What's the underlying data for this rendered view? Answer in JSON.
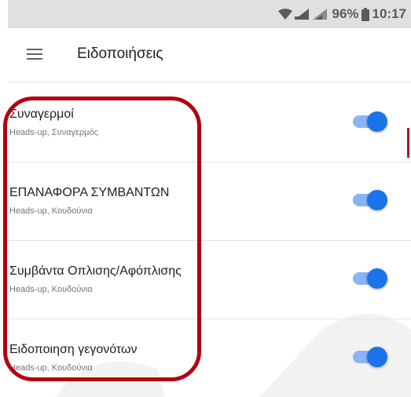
{
  "status_bar": {
    "battery": "96%",
    "time": "10:17",
    "icons": [
      "wifi-icon",
      "signal-icon",
      "signal-icon",
      "battery-icon"
    ]
  },
  "app_bar": {
    "title": "Ειδοποιήσεις",
    "menu_icon": "menu-icon"
  },
  "notifications": [
    {
      "title": "Συναγερμοί",
      "subtitle": "Heads-up, Συναγερμός",
      "enabled": true
    },
    {
      "title": "ΕΠΑΝΑΦΟΡΑ ΣΥΜΒΑΝΤΩΝ",
      "subtitle": "Heads-up, Κουδούνια",
      "enabled": true
    },
    {
      "title": "Συμβάντα Οπλισης/Αφόπλισης",
      "subtitle": "Heads-up, Κουδούνια",
      "enabled": true
    },
    {
      "title": "Ειδοποιηση γεγονότων",
      "subtitle": "Heads-up, Κουδούνια",
      "enabled": true
    }
  ],
  "colors": {
    "accent": "#1a73e8",
    "track": "#8ab4f8",
    "annotation": "#b3000f"
  }
}
